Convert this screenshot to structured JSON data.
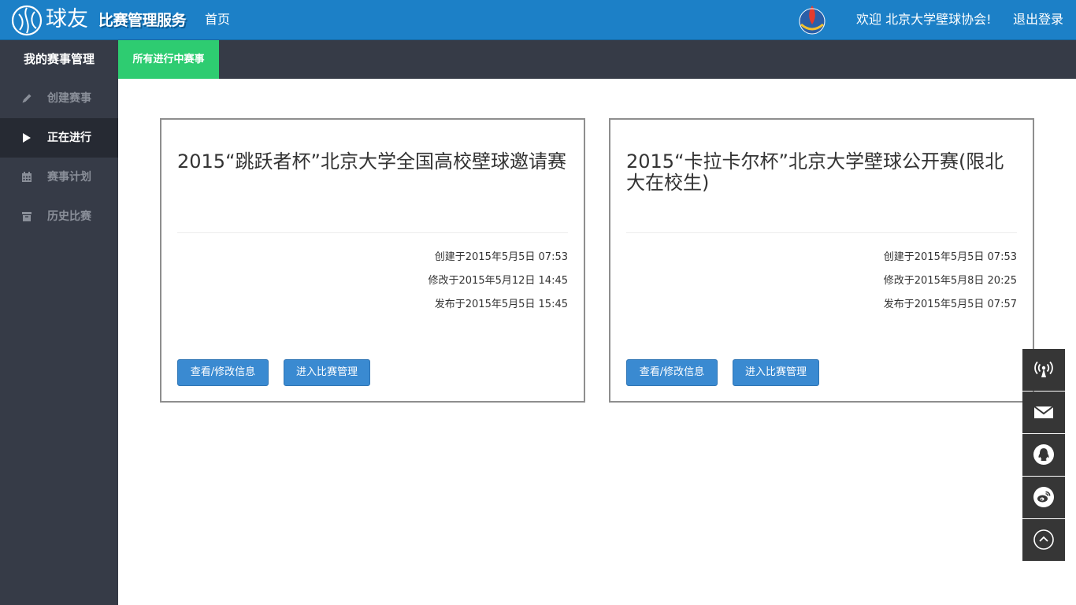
{
  "header": {
    "brand": "球友",
    "service_title": "比赛管理服务",
    "home_link": "首页",
    "welcome": "欢迎 北京大学壁球协会!",
    "logout": "退出登录",
    "brand_color": "#1c80c7"
  },
  "sidebar": {
    "title": "我的赛事管理",
    "items": [
      {
        "label": "创建赛事",
        "icon": "pencil-icon",
        "active": false
      },
      {
        "label": "正在进行",
        "icon": "play-icon",
        "active": true
      },
      {
        "label": "赛事计划",
        "icon": "calendar-icon",
        "active": false
      },
      {
        "label": "历史比赛",
        "icon": "archive-icon",
        "active": false
      }
    ]
  },
  "tabs": {
    "active_label": "所有进行中赛事",
    "active_color": "#2ecc71"
  },
  "cards": [
    {
      "title": "2015“跳跃者杯”北京大学全国高校壁球邀请赛",
      "created": "创建于2015年5月5日 07:53",
      "modified": "修改于2015年5月12日 14:45",
      "published": "发布于2015年5月5日 15:45",
      "view_button": "查看/修改信息",
      "manage_button": "进入比赛管理"
    },
    {
      "title": "2015“卡拉卡尔杯”北京大学壁球公开赛(限北大在校生)",
      "created": "创建于2015年5月5日 07:53",
      "modified": "修改于2015年5月8日 20:25",
      "published": "发布于2015年5月5日 07:57",
      "view_button": "查看/修改信息",
      "manage_button": "进入比赛管理"
    }
  ],
  "float_tools": [
    "broadcast-icon",
    "mail-icon",
    "qq-icon",
    "weibo-icon",
    "back-to-top-icon"
  ]
}
